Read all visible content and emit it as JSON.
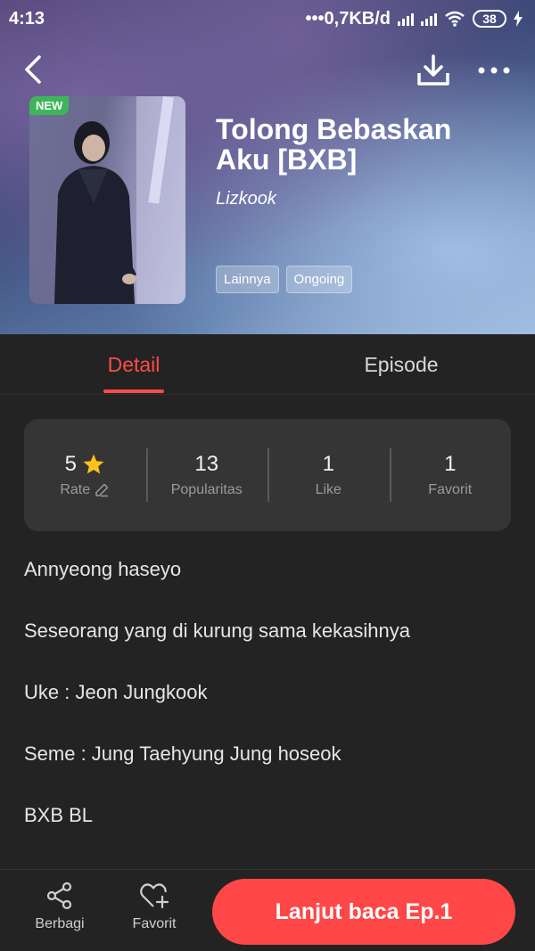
{
  "status_bar": {
    "time": "4:13",
    "network_speed": "0,7KB/d",
    "battery": "38"
  },
  "book": {
    "badge": "NEW",
    "title": "Tolong Bebaskan Aku [BXB]",
    "author": "Lizkook",
    "tags": [
      "Lainnya",
      "Ongoing"
    ]
  },
  "tabs": {
    "detail": "Detail",
    "episode": "Episode"
  },
  "stats": [
    {
      "value": "5",
      "label": "Rate"
    },
    {
      "value": "13",
      "label": "Popularitas"
    },
    {
      "value": "1",
      "label": "Like"
    },
    {
      "value": "1",
      "label": "Favorit"
    }
  ],
  "description": [
    "Annyeong haseyo",
    "Seseorang yang di kurung sama kekasihnya",
    "Uke : Jeon Jungkook",
    "Seme : Jung Taehyung Jung hoseok",
    "BXB BL"
  ],
  "bottom_bar": {
    "share_label": "Berbagi",
    "favorite_label": "Favorit",
    "read_button": "Lanjut baca Ep.1"
  },
  "colors": {
    "accent": "#ff4747",
    "background": "#232323",
    "card": "#353535",
    "new_badge": "#3fb55a",
    "star": "#ffc21a"
  }
}
